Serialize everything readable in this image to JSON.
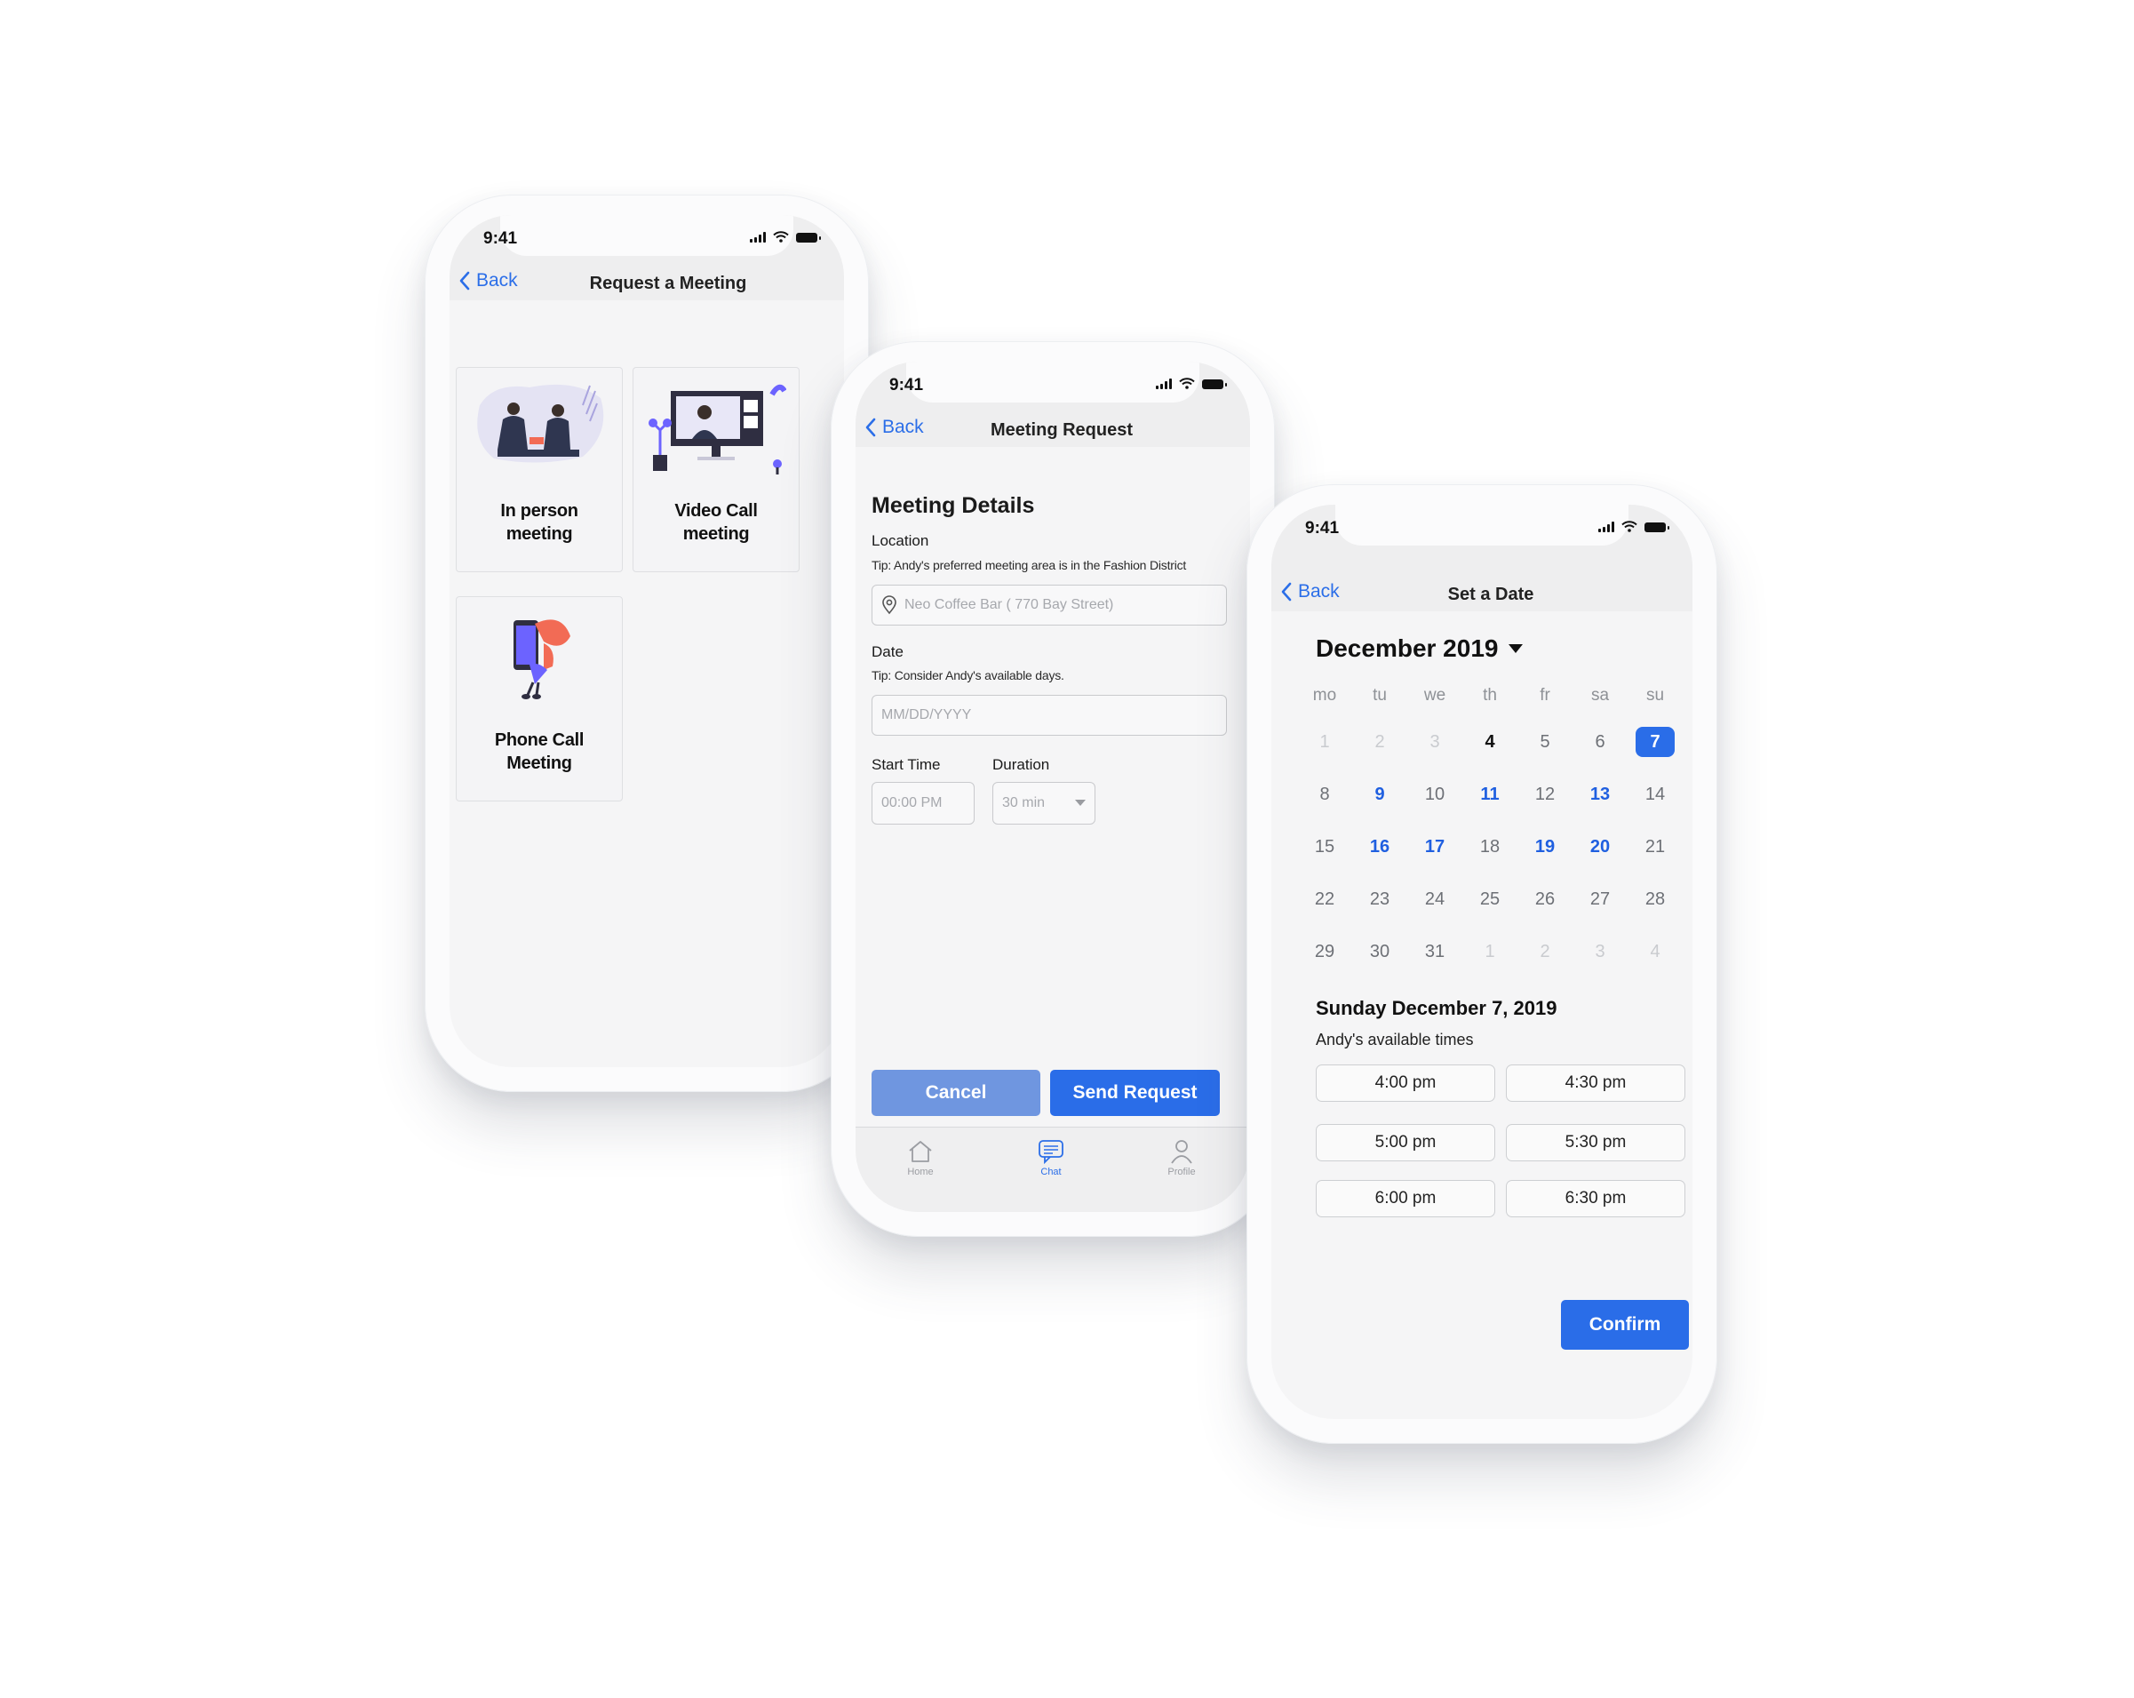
{
  "status_time": "9:41",
  "back_label": "Back",
  "phone1": {
    "title": "Request a Meeting",
    "options": [
      {
        "label": "In person meeting",
        "line1": "In person",
        "line2": "meeting"
      },
      {
        "label": "Video Call meeting",
        "line1": "Video Call",
        "line2": "meeting"
      },
      {
        "label": "Phone Call Meeting",
        "line1": "Phone Call",
        "line2": "Meeting"
      }
    ]
  },
  "phone2": {
    "title": "Meeting Request",
    "section_title": "Meeting Details",
    "location": {
      "label": "Location",
      "tip": "Tip: Andy's preferred meeting area is in the Fashion District",
      "placeholder": "Neo Coffee Bar ( 770 Bay Street)"
    },
    "date": {
      "label": "Date",
      "tip": "Tip: Consider Andy's available days.",
      "placeholder": "MM/DD/YYYY"
    },
    "start_time": {
      "label": "Start Time",
      "placeholder": "00:00 PM"
    },
    "duration": {
      "label": "Duration",
      "value": "30 min"
    },
    "cancel_label": "Cancel",
    "send_label": "Send Request",
    "tabs": {
      "home": "Home",
      "chat": "Chat",
      "profile": "Profile"
    }
  },
  "phone3": {
    "title": "Set a Date",
    "month_label": "December 2019",
    "weekdays": [
      "mo",
      "tu",
      "we",
      "th",
      "fr",
      "sa",
      "su"
    ],
    "weeks": [
      [
        {
          "d": "1",
          "s": "muted"
        },
        {
          "d": "2",
          "s": "muted"
        },
        {
          "d": "3",
          "s": "muted"
        },
        {
          "d": "4",
          "s": "dark"
        },
        {
          "d": "5",
          "s": "norm"
        },
        {
          "d": "6",
          "s": "norm"
        },
        {
          "d": "7",
          "s": "sel"
        }
      ],
      [
        {
          "d": "8",
          "s": "norm"
        },
        {
          "d": "9",
          "s": "blue"
        },
        {
          "d": "10",
          "s": "norm"
        },
        {
          "d": "11",
          "s": "blue"
        },
        {
          "d": "12",
          "s": "norm"
        },
        {
          "d": "13",
          "s": "blue"
        },
        {
          "d": "14",
          "s": "norm"
        }
      ],
      [
        {
          "d": "15",
          "s": "norm"
        },
        {
          "d": "16",
          "s": "blue"
        },
        {
          "d": "17",
          "s": "blue"
        },
        {
          "d": "18",
          "s": "norm"
        },
        {
          "d": "19",
          "s": "blue"
        },
        {
          "d": "20",
          "s": "blue"
        },
        {
          "d": "21",
          "s": "norm"
        }
      ],
      [
        {
          "d": "22",
          "s": "norm"
        },
        {
          "d": "23",
          "s": "norm"
        },
        {
          "d": "24",
          "s": "norm"
        },
        {
          "d": "25",
          "s": "norm"
        },
        {
          "d": "26",
          "s": "norm"
        },
        {
          "d": "27",
          "s": "norm"
        },
        {
          "d": "28",
          "s": "norm"
        }
      ],
      [
        {
          "d": "29",
          "s": "norm"
        },
        {
          "d": "30",
          "s": "norm"
        },
        {
          "d": "31",
          "s": "norm"
        },
        {
          "d": "1",
          "s": "muted"
        },
        {
          "d": "2",
          "s": "muted"
        },
        {
          "d": "3",
          "s": "muted"
        },
        {
          "d": "4",
          "s": "muted"
        }
      ]
    ],
    "selected_date_label": "Sunday December 7, 2019",
    "available_label": "Andy's available times",
    "times": [
      "4:00 pm",
      "4:30 pm",
      "5:00 pm",
      "5:30 pm",
      "6:00 pm",
      "6:30 pm"
    ],
    "confirm_label": "Confirm"
  },
  "colors": {
    "accent": "#2a6de8",
    "accent_text": "#2b6ee8",
    "cancel": "#6f96e0",
    "illustration_purple": "#6c63ff",
    "illustration_coral": "#f26b55"
  }
}
